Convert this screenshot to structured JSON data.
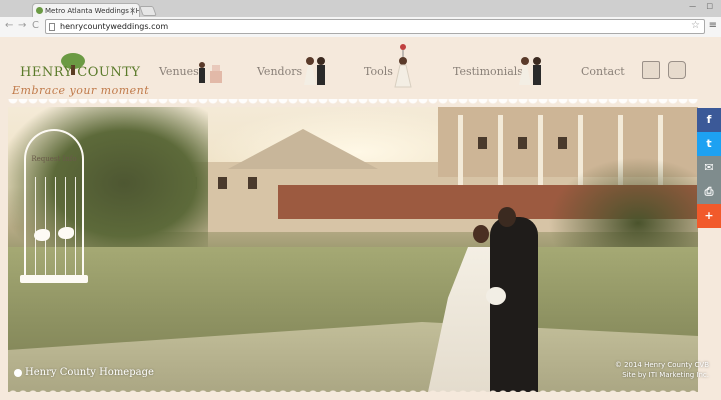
{
  "browser": {
    "tab_title": "Metro Atlanta Weddings | H",
    "tab_close": "×",
    "url": "henrycountyweddings.com",
    "back_symbol": "←",
    "forward_symbol": "→",
    "reload_symbol": "C",
    "star_symbol": "☆",
    "menu_symbol": "≡"
  },
  "logo": {
    "title": "HENRY COUNTY",
    "tagline": "Embrace your moment"
  },
  "nav": {
    "items": [
      {
        "label": "Venues"
      },
      {
        "label": "Vendors"
      },
      {
        "label": "Tools"
      },
      {
        "label": "Testimonials"
      },
      {
        "label": "Contact"
      }
    ]
  },
  "hero": {
    "request_info_label": "Request Info",
    "home_link": "Henry County Homepage",
    "copyright": "© 2014 Henry County CVB",
    "credit": "Site by ITI Marketing Inc."
  },
  "share": {
    "buttons": [
      {
        "icon": "facebook-icon",
        "glyph": "f",
        "color": "#3b5998"
      },
      {
        "icon": "twitter-icon",
        "glyph": "t",
        "color": "#1da1f2"
      },
      {
        "icon": "email-icon",
        "glyph": "✉",
        "color": "#7f8c8d"
      },
      {
        "icon": "print-icon",
        "glyph": "⎙",
        "color": "#7f8c8d"
      },
      {
        "icon": "plus-icon",
        "glyph": "+",
        "color": "#f15a2b"
      }
    ]
  }
}
